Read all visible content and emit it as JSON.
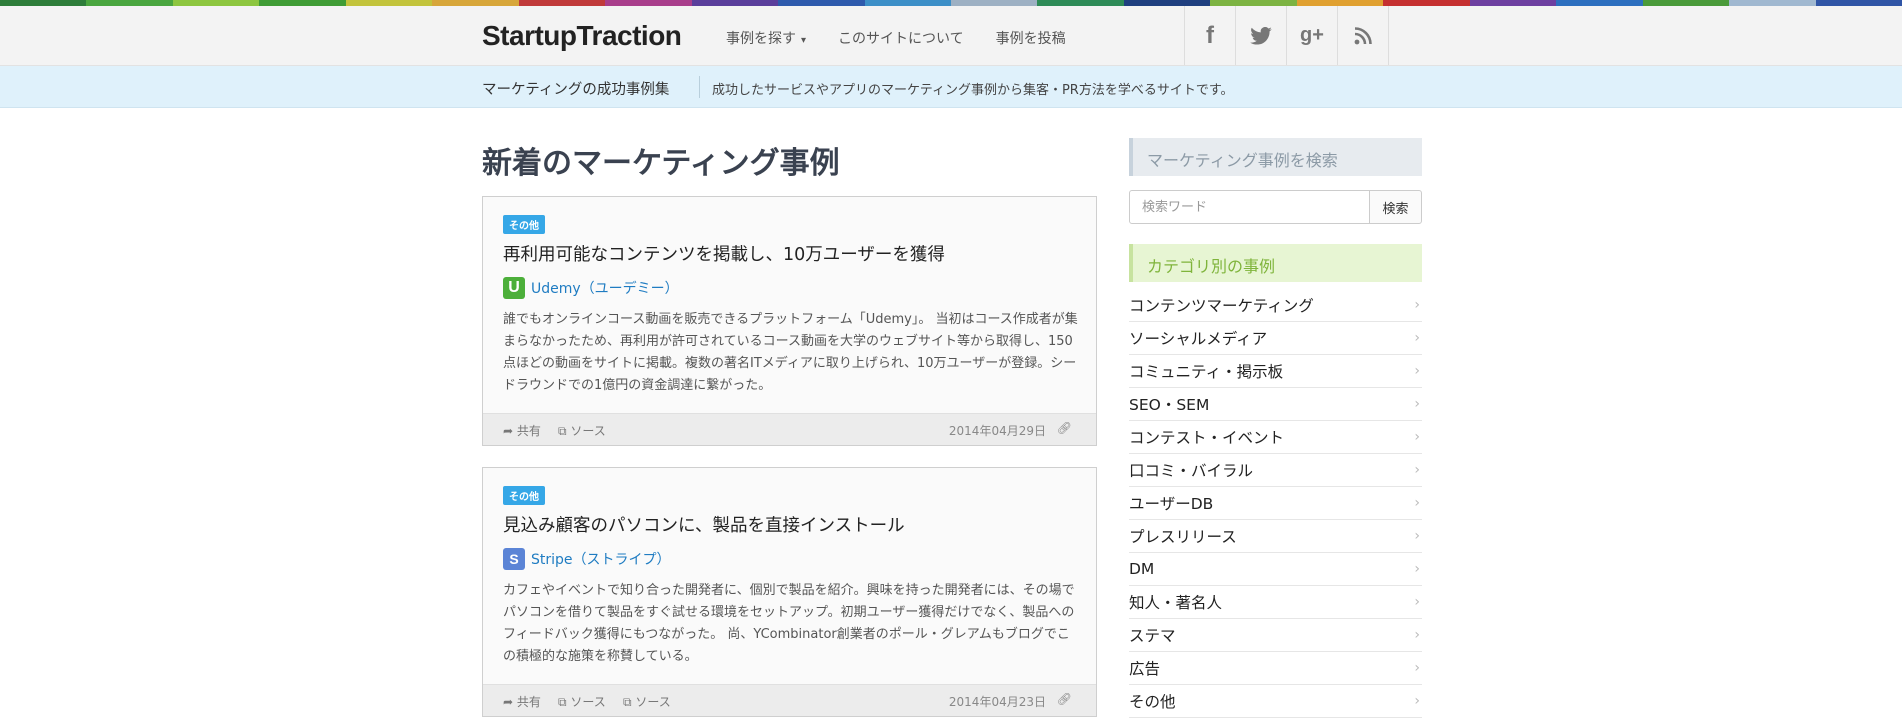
{
  "stripe_colors": [
    "#2d7d3a",
    "#4aa63f",
    "#8dc63f",
    "#3f9c35",
    "#c2c33b",
    "#d7a63a",
    "#c03a3a",
    "#a83d8b",
    "#5a3e9b",
    "#2e5aac",
    "#3c8fc7",
    "#9db0c3",
    "#2e8b57",
    "#1f3f7f",
    "#7cb342",
    "#e0a030",
    "#c53030",
    "#6d3fa0",
    "#2c6fbf",
    "#4a9a3a",
    "#a0b8d0",
    "#3055a6"
  ],
  "header": {
    "logo": "StartupTraction",
    "nav": [
      {
        "label": "事例を探す",
        "caret": "▾"
      },
      {
        "label": "このサイトについて"
      },
      {
        "label": "事例を投稿"
      }
    ],
    "social": [
      {
        "icon": "facebook-icon",
        "glyph": "f"
      },
      {
        "icon": "twitter-icon",
        "glyph": "🐦"
      },
      {
        "icon": "google-plus-icon",
        "glyph": "g+"
      },
      {
        "icon": "rss-icon",
        "glyph": "⌯"
      }
    ]
  },
  "tagbar": {
    "title": "マーケティングの成功事例集",
    "description": "成功したサービスやアプリのマーケティング事例から集客・PR方法を学べるサイトです。"
  },
  "main": {
    "title": "新着のマーケティング事例",
    "cards": [
      {
        "badge": "その他",
        "title": "再利用可能なコンテンツを掲載し、10万ユーザーを獲得",
        "company": "Udemy（ユーデミー）",
        "company_icon": "U",
        "company_color": "#4caf3a",
        "body": "誰でもオンラインコース動画を販売できるプラットフォーム「Udemy」。 当初はコース作成者が集まらなかったため、再利用が許可されているコース動画を大学のウェブサイト等から取得し、150点ほどの動画をサイトに掲載。複数の著名ITメディアに取り上げられ、10万ユーザーが登録。シードラウンドでの1億円の資金調達に繋がった。",
        "share": "共有",
        "sources": [
          "ソース"
        ],
        "date": "2014年04月29日"
      },
      {
        "badge": "その他",
        "title": "見込み顧客のパソコンに、製品を直接インストール",
        "company": "Stripe（ストライプ）",
        "company_icon": "S",
        "company_color": "#5b84d6",
        "body": "カフェやイベントで知り合った開発者に、個別で製品を紹介。興味を持った開発者には、その場でパソコンを借りて製品をすぐ試せる環境をセットアップ。初期ユーザー獲得だけでなく、製品へのフィードバック獲得にもつながった。 尚、YCombinator創業者のポール・グレアムもブログでこの積極的な施策を称賛している。",
        "share": "共有",
        "sources": [
          "ソース",
          "ソース"
        ],
        "date": "2014年04月23日"
      }
    ]
  },
  "sidebar": {
    "search_heading": "マーケティング事例を検索",
    "search_placeholder": "検索ワード",
    "search_button": "検索",
    "category_heading": "カテゴリ別の事例",
    "categories": [
      "コンテンツマーケティング",
      "ソーシャルメディア",
      "コミュニティ・掲示板",
      "SEO・SEM",
      "コンテスト・イベント",
      "口コミ・バイラル",
      "ユーザーDB",
      "プレスリリース",
      "DM",
      "知人・著名人",
      "ステマ",
      "広告",
      "その他"
    ]
  }
}
